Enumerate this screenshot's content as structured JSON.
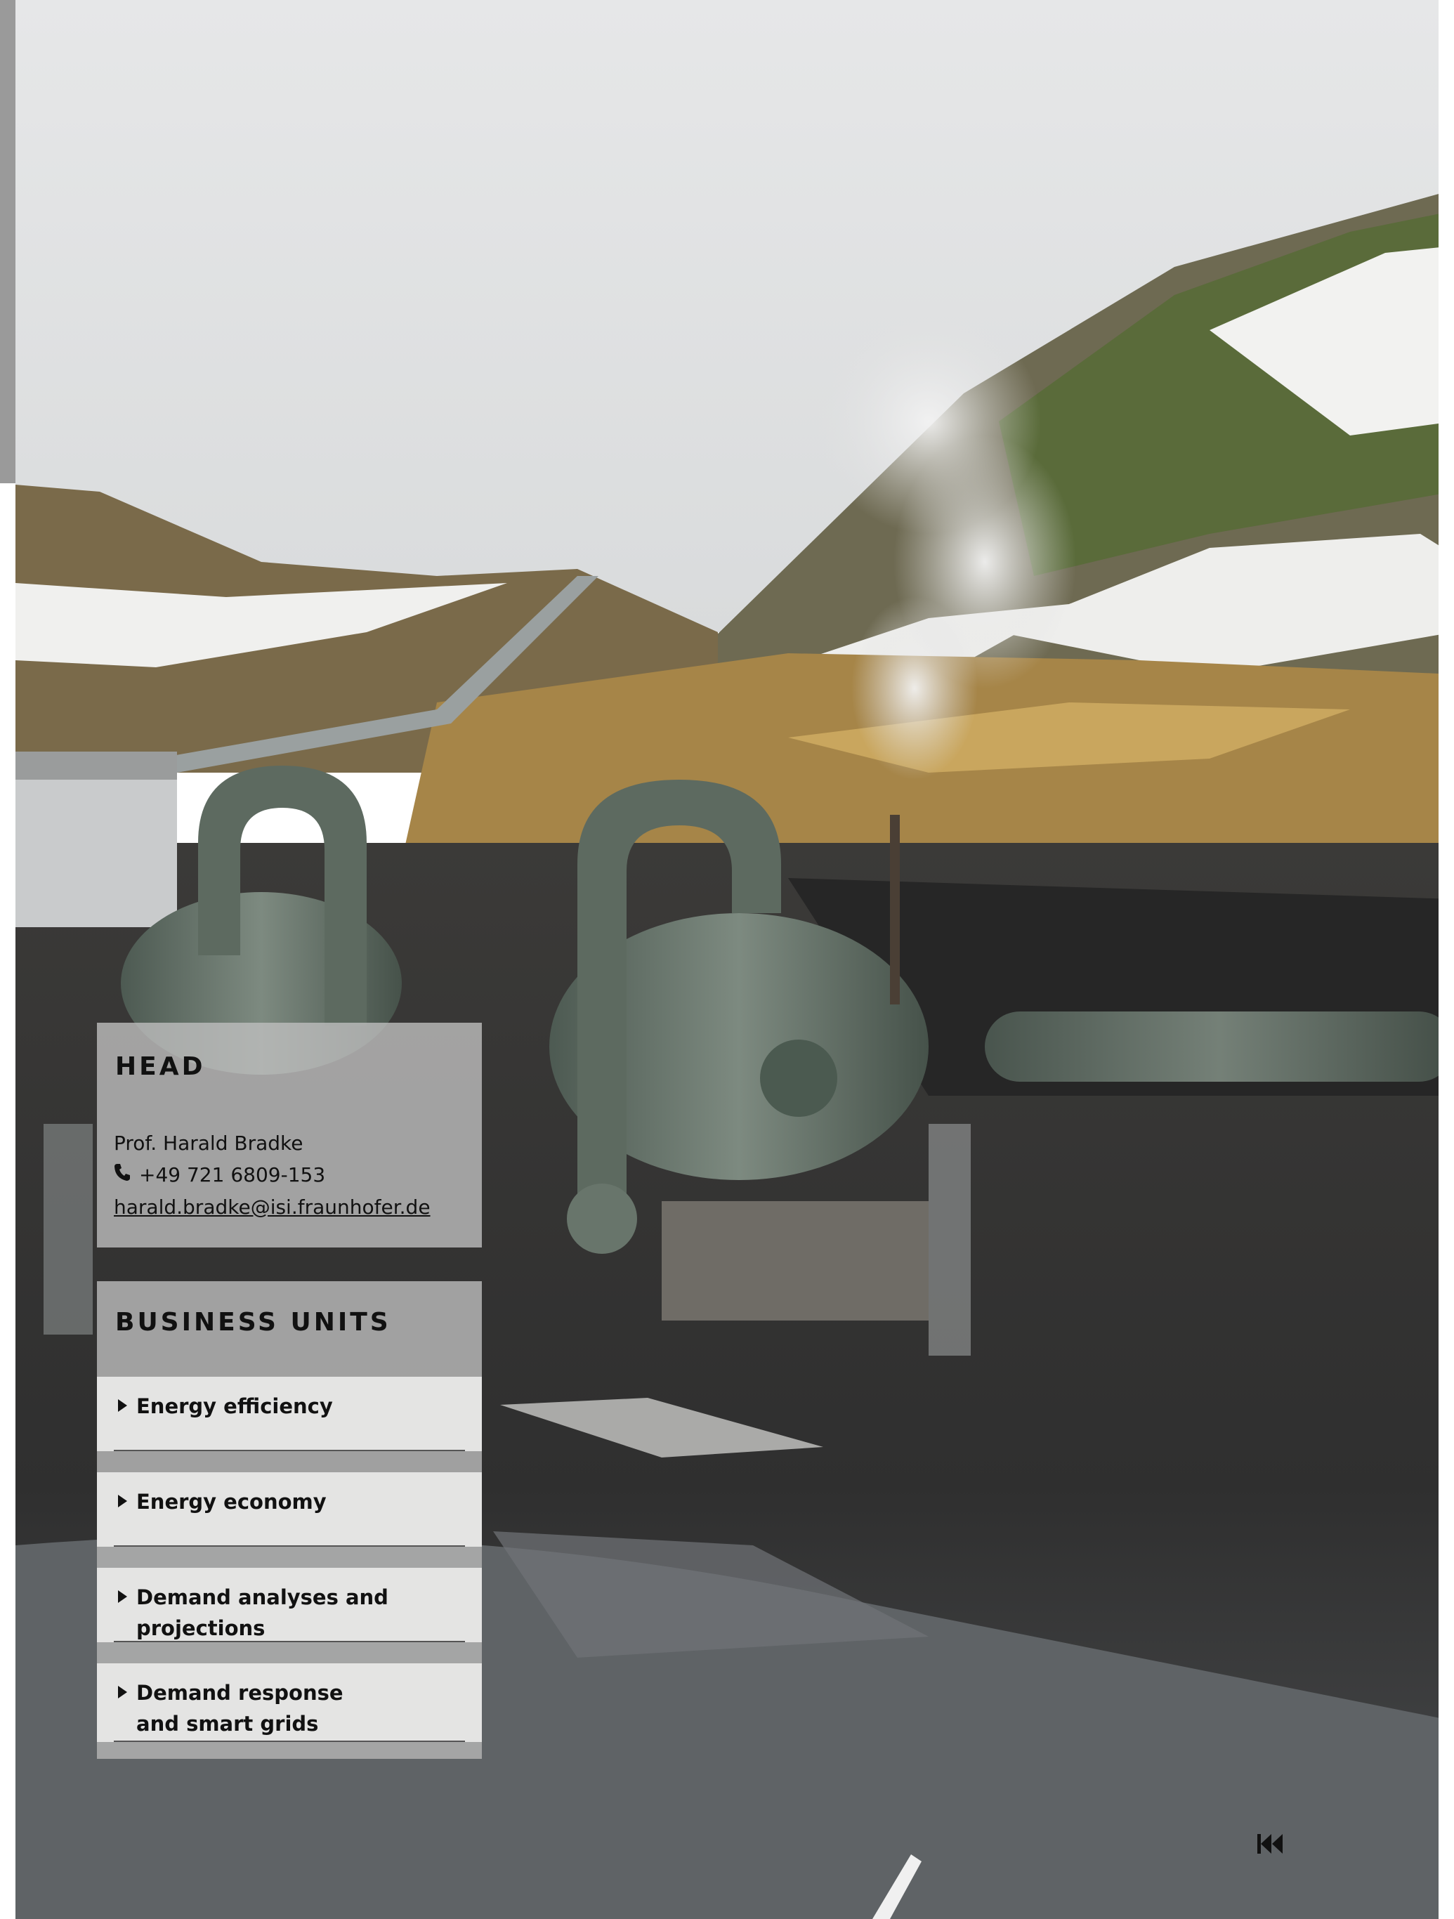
{
  "head": {
    "title": "HEAD",
    "name": "Prof. Harald Bradke",
    "phone": "+49 721 6809-153",
    "email": "harald.bradke@isi.fraunhofer.de"
  },
  "business_units": {
    "title": "BUSINESS UNITS",
    "items": [
      {
        "label": "Energy efficiency"
      },
      {
        "label": "Energy economy"
      },
      {
        "label": "Demand analyses and projections"
      },
      {
        "label": "Demand response and smart grids"
      }
    ]
  },
  "navigation": {
    "back_icon": "skip-to-start-icon"
  },
  "colors": {
    "panel_bg": "#bebebe",
    "item_bg": "#e4e4e3",
    "text": "#111111",
    "sidebar_bar": "#9a9a9a"
  }
}
